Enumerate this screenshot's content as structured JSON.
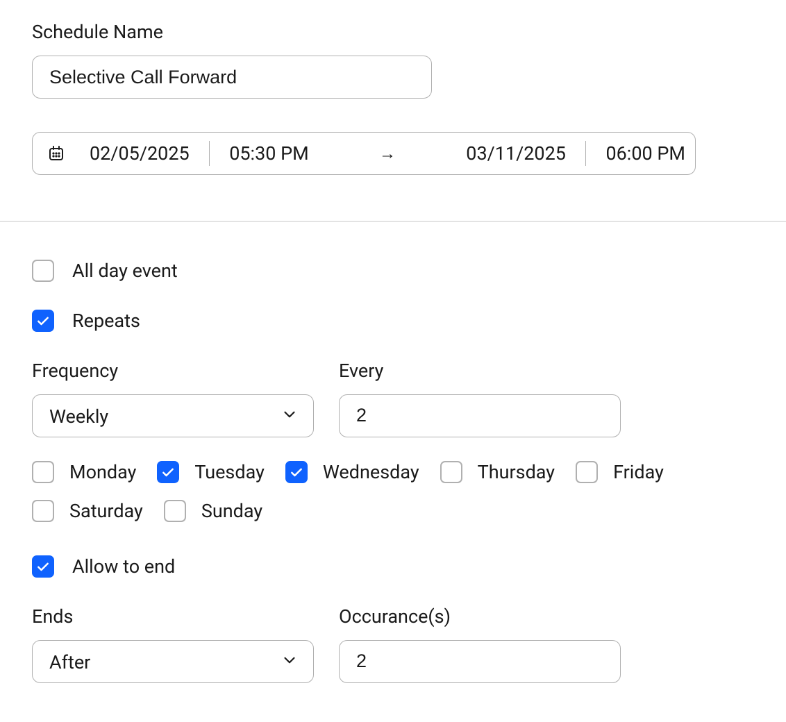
{
  "schedule": {
    "name_label": "Schedule Name",
    "name_value": "Selective Call Forward",
    "start_date": "02/05/2025",
    "start_time": "05:30 PM",
    "end_date": "03/11/2025",
    "end_time": "06:00 PM"
  },
  "options": {
    "all_day_label": "All day event",
    "all_day_checked": false,
    "repeats_label": "Repeats",
    "repeats_checked": true,
    "frequency_label": "Frequency",
    "frequency_value": "Weekly",
    "every_label": "Every",
    "every_value": "2",
    "days": [
      {
        "label": "Monday",
        "checked": false
      },
      {
        "label": "Tuesday",
        "checked": true
      },
      {
        "label": "Wednesday",
        "checked": true
      },
      {
        "label": "Thursday",
        "checked": false
      },
      {
        "label": "Friday",
        "checked": false
      },
      {
        "label": "Saturday",
        "checked": false
      },
      {
        "label": "Sunday",
        "checked": false
      }
    ],
    "allow_end_label": "Allow to end",
    "allow_end_checked": true,
    "ends_label": "Ends",
    "ends_value": "After",
    "occurrence_label": "Occurance(s)",
    "occurrence_value": "2"
  }
}
